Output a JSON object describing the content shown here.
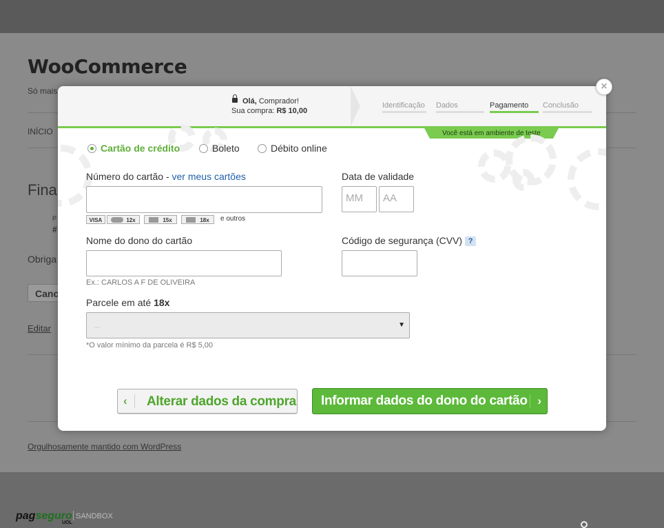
{
  "background_site": {
    "title": "WooCommerce",
    "tagline": "Só mais",
    "nav_item": "INÍCIO",
    "heading": "Fina",
    "small_label": "P",
    "small_value": "#",
    "thanks_text": "Obriga",
    "cancel_label": "Cance",
    "edit_link": "Editar",
    "footer_link": "Orgulhosamente mantido com WordPress"
  },
  "pagseguro_footer": {
    "logo_pag": "pag",
    "logo_seguro": "seguro",
    "logo_uol": "UOL",
    "env_label": "SANDBOX"
  },
  "modal": {
    "close_label": "×",
    "greeting_prefix": "Olá,",
    "greeting_name": "Comprador!",
    "purchase_label": "Sua compra:",
    "purchase_value": "R$ 10,00",
    "steps": [
      {
        "label": "Identificação",
        "active": false
      },
      {
        "label": "Dados",
        "active": false
      },
      {
        "label": "Pagamento",
        "active": true
      },
      {
        "label": "Conclusão",
        "active": false
      }
    ],
    "sandbox_banner": "Você está em ambiente de teste",
    "payment_methods": [
      {
        "label": "Cartão de crédito",
        "selected": true
      },
      {
        "label": "Boleto",
        "selected": false
      },
      {
        "label": "Débito online",
        "selected": false
      }
    ],
    "card_number_label": "Número do cartão - ",
    "card_number_link": "ver meus cartões",
    "card_number_value": "",
    "cards": [
      {
        "name": "VISA",
        "installments": ""
      },
      {
        "name": "MASTERCARD",
        "installments": "12x"
      },
      {
        "name": "AMEX",
        "installments": "15x"
      },
      {
        "name": "DINERS",
        "installments": "18x"
      }
    ],
    "cards_others": "e outros",
    "validity_label": "Data de validade",
    "month_placeholder": "MM",
    "year_placeholder": "AA",
    "holder_label": "Nome do dono do cartão",
    "holder_value": "",
    "holder_hint": "Ex.: CARLOS A F DE OLIVEIRA",
    "cvv_label": "Código de segurança (CVV)",
    "cvv_help": "?",
    "cvv_value": "",
    "installments_label": "Parcele em até ",
    "installments_max": "18x",
    "installments_selected": "...",
    "installments_hint": "*O valor mínimo da parcela é R$ 5,00",
    "back_button": "Alterar dados da compra",
    "back_icon": "‹",
    "next_button": "Informar dados do dono do cartão",
    "next_icon": "›"
  },
  "colors": {
    "accent_green": "#5cb93a",
    "link_blue": "#1f5fa8",
    "overlay": "#8a8a8a"
  }
}
